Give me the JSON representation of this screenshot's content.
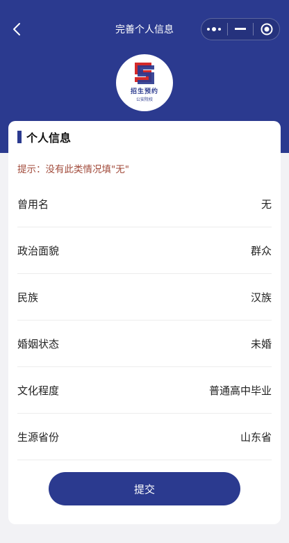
{
  "nav": {
    "title": "完善个人信息"
  },
  "logo": {
    "line1": "招生预约",
    "line2": "公安院校"
  },
  "section": {
    "title": "个人信息"
  },
  "hint": "提示：没有此类情况填\"无\"",
  "rows": [
    {
      "label": "曾用名",
      "value": "无"
    },
    {
      "label": "政治面貌",
      "value": "群众"
    },
    {
      "label": "民族",
      "value": "汉族"
    },
    {
      "label": "婚姻状态",
      "value": "未婚"
    },
    {
      "label": "文化程度",
      "value": "普通高中毕业"
    },
    {
      "label": "生源省份",
      "value": "山东省"
    }
  ],
  "submit_label": "提交",
  "colors": {
    "primary": "#2b3a8f",
    "hint": "#a14a3a",
    "logo_red": "#d42a2a"
  }
}
